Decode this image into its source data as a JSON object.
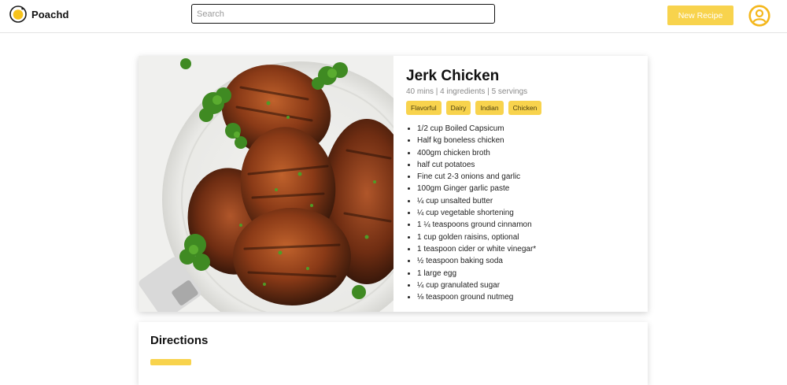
{
  "app": {
    "name": "Poachd"
  },
  "header": {
    "search_placeholder": "Search",
    "new_recipe_label": "New Recipe"
  },
  "colors": {
    "accent": "#f8d34d",
    "border": "#111111"
  },
  "recipe": {
    "title": "Jerk Chicken",
    "meta": "40 mins | 4 ingredients | 5 servings",
    "tags": [
      "Flavorful",
      "Dairy",
      "Indian",
      "Chicken"
    ],
    "ingredients": [
      "1/2 cup Boiled Capsicum",
      "Half kg boneless chicken",
      "400gm chicken broth",
      "half cut potatoes",
      "Fine cut 2-3 onions and garlic",
      "100gm Ginger garlic paste",
      "¼ cup unsalted butter",
      "¼ cup vegetable shortening",
      "1 ¼ teaspoons ground cinnamon",
      "1 cup golden raisins, optional",
      "1 teaspoon cider or white vinegar*",
      "½ teaspoon baking soda",
      "1 large egg",
      "¼ cup granulated sugar",
      "⅛ teaspoon ground nutmeg"
    ]
  },
  "directions": {
    "title": "Directions"
  }
}
